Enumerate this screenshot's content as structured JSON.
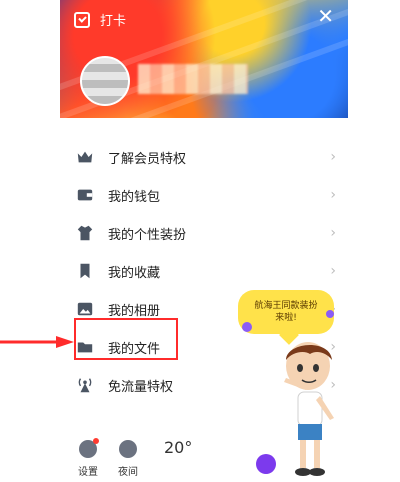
{
  "header": {
    "checkin_label": "打卡",
    "close_symbol": "✕"
  },
  "menu": {
    "items": [
      {
        "label": "了解会员特权",
        "icon": "crown-icon"
      },
      {
        "label": "我的钱包",
        "icon": "wallet-icon"
      },
      {
        "label": "我的个性装扮",
        "icon": "shirt-icon"
      },
      {
        "label": "我的收藏",
        "icon": "bookmark-icon"
      },
      {
        "label": "我的相册",
        "icon": "photo-icon"
      },
      {
        "label": "我的文件",
        "icon": "folder-icon"
      },
      {
        "label": "免流量特权",
        "icon": "antenna-icon"
      }
    ]
  },
  "bottom": {
    "settings_label": "设置",
    "night_label": "夜间",
    "temperature": "20°"
  },
  "promo": {
    "line1": "航海王同款装扮",
    "line2": "来啦!"
  },
  "colors": {
    "accent_red": "#ff2b2b",
    "icon_gray": "#4b5563",
    "bubble_yellow": "#ffe24a"
  }
}
